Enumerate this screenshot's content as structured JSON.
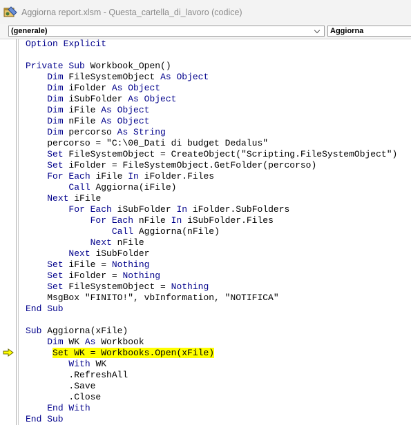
{
  "window": {
    "title": "Aggiorna report.xlsm - Questa_cartella_di_lavoro (codice)",
    "icon": "vba-module-icon"
  },
  "toolbar": {
    "object_combo": "(generale)",
    "procedure_combo": "Aggiorna"
  },
  "editor": {
    "current_line": 28,
    "keyword_color": "#00008b",
    "highlight_color": "#ffff00",
    "lines": [
      [
        {
          "t": "Option Explicit",
          "k": 1
        }
      ],
      [],
      [
        {
          "t": "Private Sub",
          "k": 1
        },
        {
          "t": " Workbook_Open()"
        }
      ],
      [
        {
          "t": "    "
        },
        {
          "t": "Dim",
          "k": 1
        },
        {
          "t": " FileSystemObject "
        },
        {
          "t": "As Object",
          "k": 1
        }
      ],
      [
        {
          "t": "    "
        },
        {
          "t": "Dim",
          "k": 1
        },
        {
          "t": " iFolder "
        },
        {
          "t": "As Object",
          "k": 1
        }
      ],
      [
        {
          "t": "    "
        },
        {
          "t": "Dim",
          "k": 1
        },
        {
          "t": " iSubFolder "
        },
        {
          "t": "As Object",
          "k": 1
        }
      ],
      [
        {
          "t": "    "
        },
        {
          "t": "Dim",
          "k": 1
        },
        {
          "t": " iFile "
        },
        {
          "t": "As Object",
          "k": 1
        }
      ],
      [
        {
          "t": "    "
        },
        {
          "t": "Dim",
          "k": 1
        },
        {
          "t": " nFile "
        },
        {
          "t": "As Object",
          "k": 1
        }
      ],
      [
        {
          "t": "    "
        },
        {
          "t": "Dim",
          "k": 1
        },
        {
          "t": " percorso "
        },
        {
          "t": "As String",
          "k": 1
        }
      ],
      [
        {
          "t": "    percorso = \"C:\\00_Dati di budget Dedalus\""
        }
      ],
      [
        {
          "t": "    "
        },
        {
          "t": "Set",
          "k": 1
        },
        {
          "t": " FileSystemObject = CreateObject(\"Scripting.FileSystemObject\")"
        }
      ],
      [
        {
          "t": "    "
        },
        {
          "t": "Set",
          "k": 1
        },
        {
          "t": " iFolder = FileSystemObject.GetFolder(percorso)"
        }
      ],
      [
        {
          "t": "    "
        },
        {
          "t": "For Each",
          "k": 1
        },
        {
          "t": " iFile "
        },
        {
          "t": "In",
          "k": 1
        },
        {
          "t": " iFolder.Files"
        }
      ],
      [
        {
          "t": "        "
        },
        {
          "t": "Call",
          "k": 1
        },
        {
          "t": " Aggiorna(iFile)"
        }
      ],
      [
        {
          "t": "    "
        },
        {
          "t": "Next",
          "k": 1
        },
        {
          "t": " iFile"
        }
      ],
      [
        {
          "t": "        "
        },
        {
          "t": "For Each",
          "k": 1
        },
        {
          "t": " iSubFolder "
        },
        {
          "t": "In",
          "k": 1
        },
        {
          "t": " iFolder.SubFolders"
        }
      ],
      [
        {
          "t": "            "
        },
        {
          "t": "For Each",
          "k": 1
        },
        {
          "t": " nFile "
        },
        {
          "t": "In",
          "k": 1
        },
        {
          "t": " iSubFolder.Files"
        }
      ],
      [
        {
          "t": "                "
        },
        {
          "t": "Call",
          "k": 1
        },
        {
          "t": " Aggiorna(nFile)"
        }
      ],
      [
        {
          "t": "            "
        },
        {
          "t": "Next",
          "k": 1
        },
        {
          "t": " nFile"
        }
      ],
      [
        {
          "t": "        "
        },
        {
          "t": "Next",
          "k": 1
        },
        {
          "t": " iSubFolder"
        }
      ],
      [
        {
          "t": "    "
        },
        {
          "t": "Set",
          "k": 1
        },
        {
          "t": " iFile = "
        },
        {
          "t": "Nothing",
          "k": 1
        }
      ],
      [
        {
          "t": "    "
        },
        {
          "t": "Set",
          "k": 1
        },
        {
          "t": " iFolder = "
        },
        {
          "t": "Nothing",
          "k": 1
        }
      ],
      [
        {
          "t": "    "
        },
        {
          "t": "Set",
          "k": 1
        },
        {
          "t": " FileSystemObject = "
        },
        {
          "t": "Nothing",
          "k": 1
        }
      ],
      [
        {
          "t": "    MsgBox \"FINITO!\", vbInformation, \"NOTIFICA\""
        }
      ],
      [
        {
          "t": "End Sub",
          "k": 1
        }
      ],
      [],
      [
        {
          "t": "Sub",
          "k": 1
        },
        {
          "t": " Aggiorna(xFile)"
        }
      ],
      [
        {
          "t": "    "
        },
        {
          "t": "Dim",
          "k": 1
        },
        {
          "t": " WK "
        },
        {
          "t": "As",
          "k": 1
        },
        {
          "t": " Workbook"
        }
      ],
      [
        {
          "t": "     "
        },
        {
          "t": "Set WK = Workbooks.Open(xFile)",
          "h": 1
        }
      ],
      [
        {
          "t": "        "
        },
        {
          "t": "With",
          "k": 1
        },
        {
          "t": " WK"
        }
      ],
      [
        {
          "t": "        .RefreshAll"
        }
      ],
      [
        {
          "t": "        .Save"
        }
      ],
      [
        {
          "t": "        .Close"
        }
      ],
      [
        {
          "t": "    "
        },
        {
          "t": "End With",
          "k": 1
        }
      ],
      [
        {
          "t": "End Sub",
          "k": 1
        }
      ]
    ]
  }
}
